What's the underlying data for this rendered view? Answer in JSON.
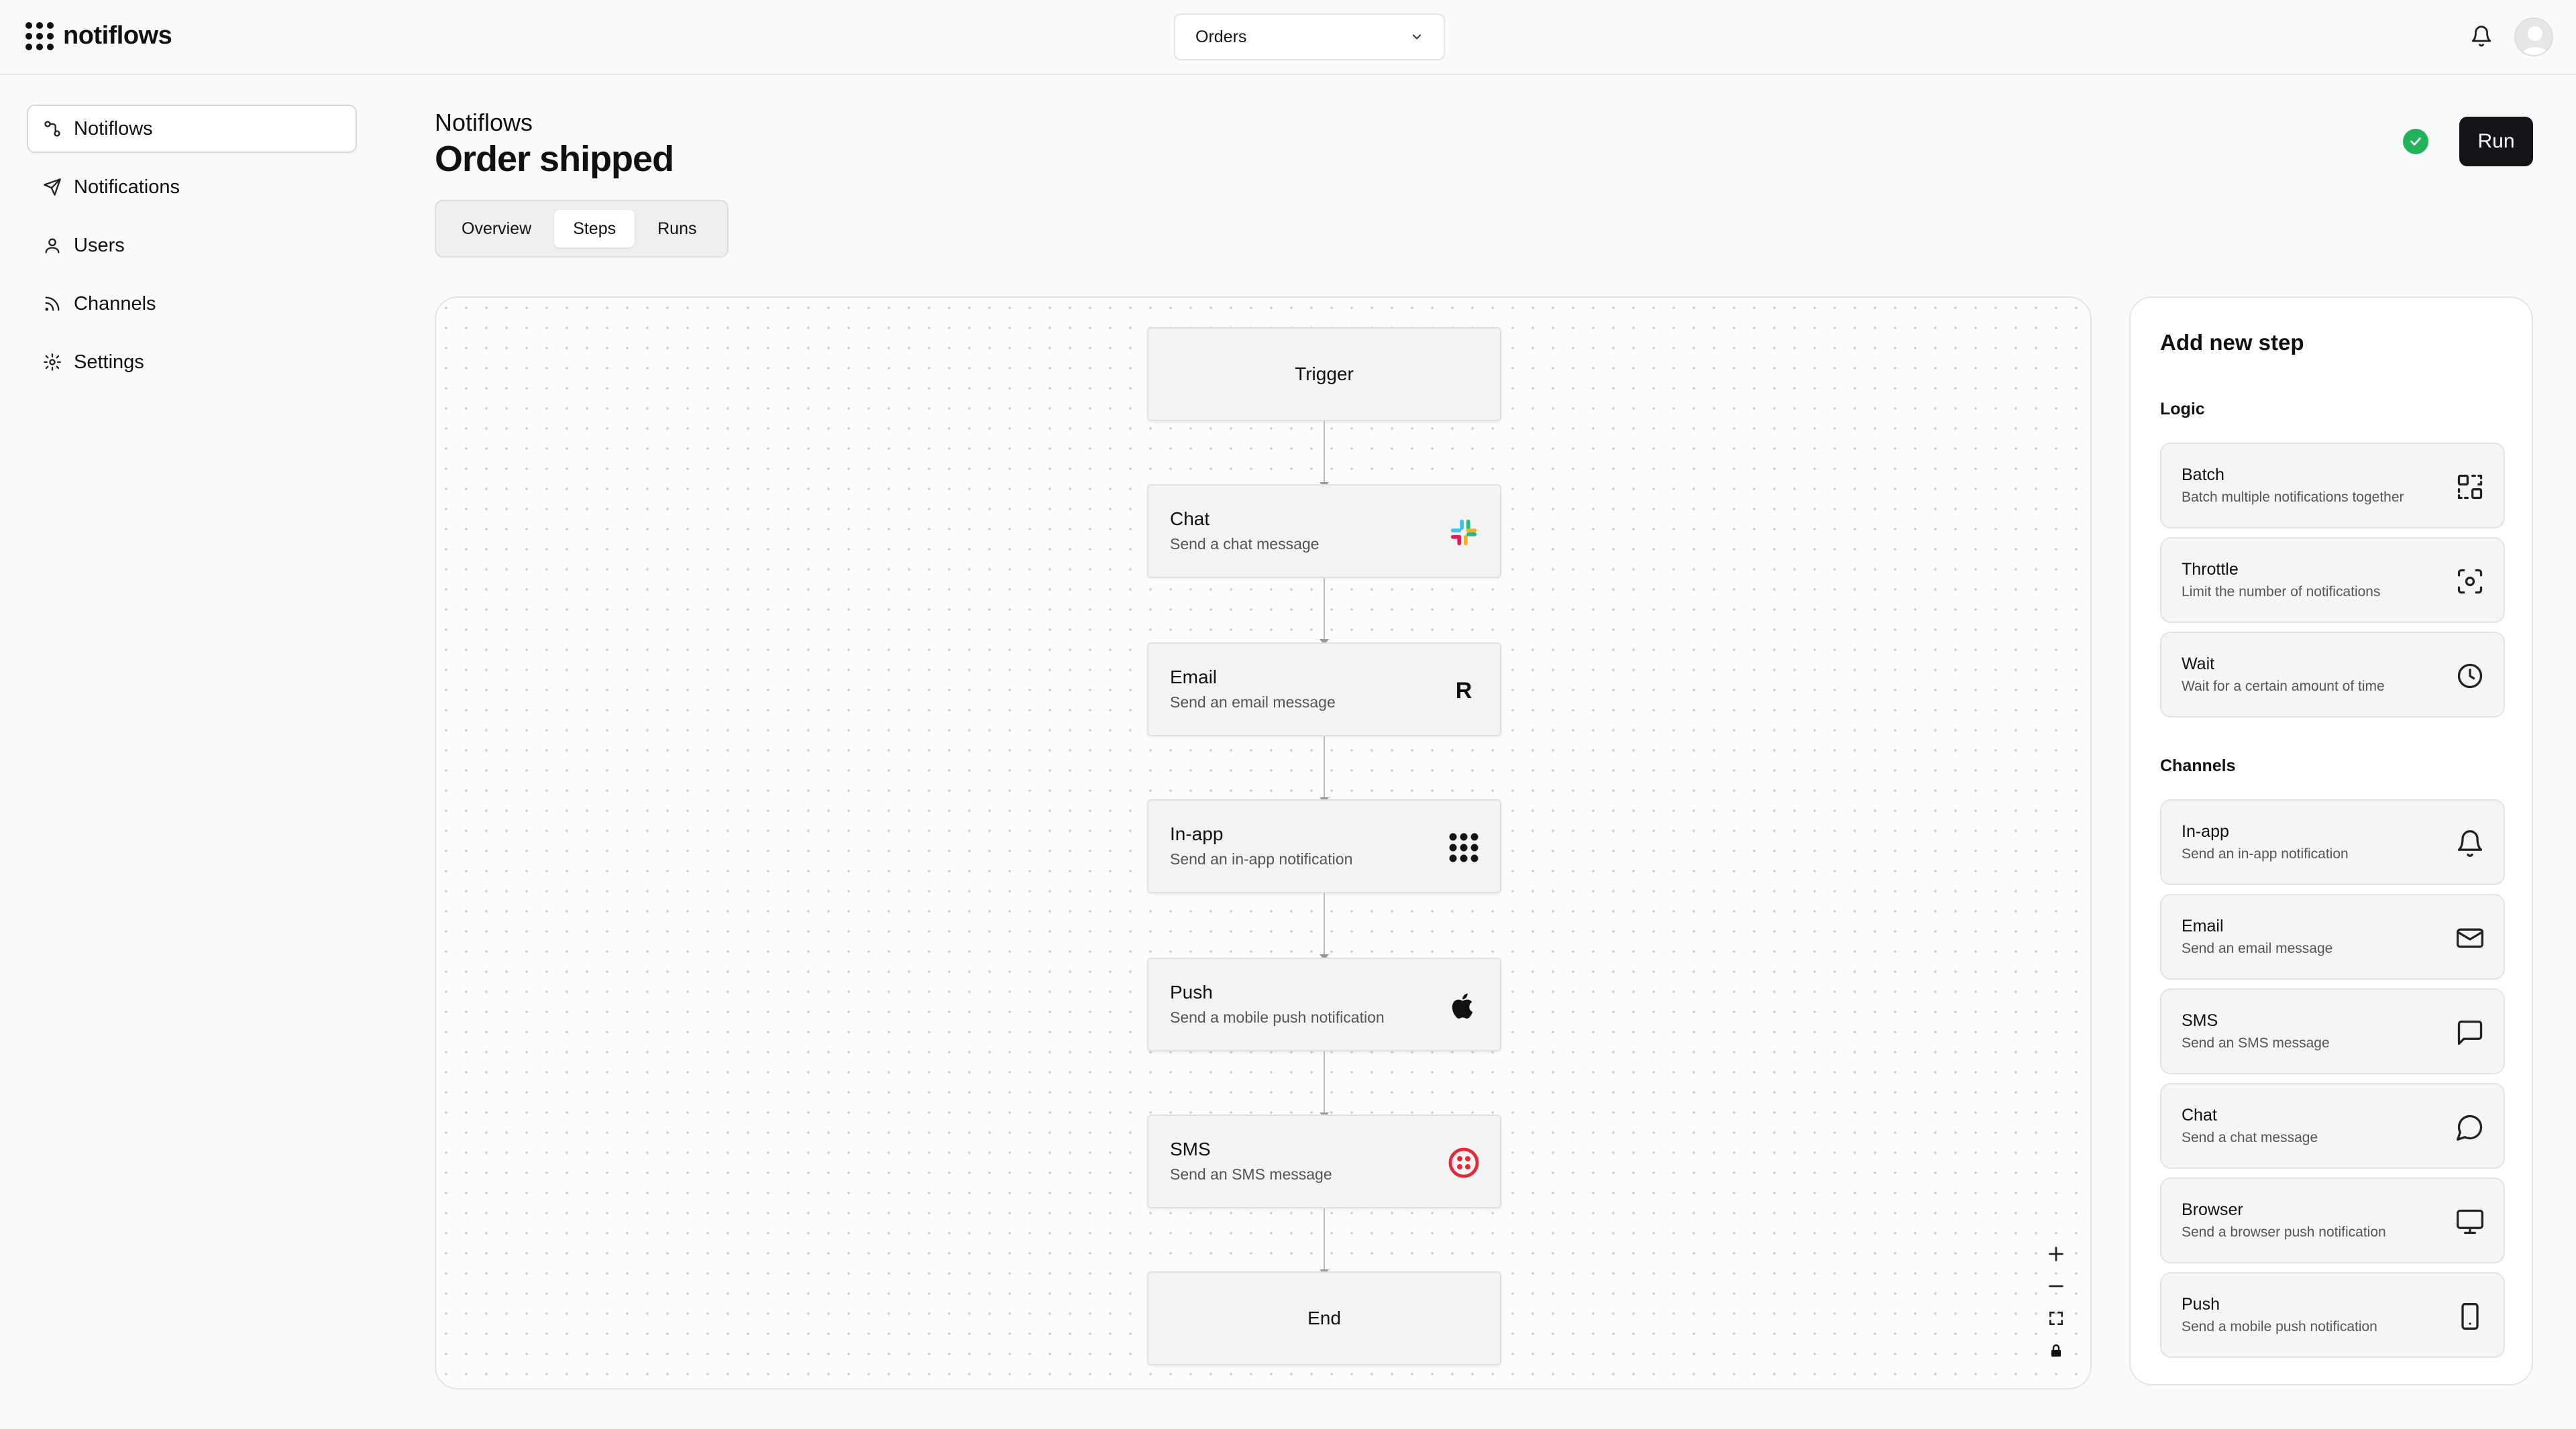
{
  "app": {
    "name": "notiflows"
  },
  "header": {
    "workflow_select": "Orders",
    "icons": [
      "grid-logo-icon",
      "chevron-down-icon",
      "bell-icon",
      "avatar"
    ]
  },
  "sidebar": {
    "items": [
      {
        "label": "Notiflows",
        "icon": "workflow-icon",
        "active": true
      },
      {
        "label": "Notifications",
        "icon": "send-icon"
      },
      {
        "label": "Users",
        "icon": "user-icon"
      },
      {
        "label": "Channels",
        "icon": "rss-icon"
      },
      {
        "label": "Settings",
        "icon": "gear-icon"
      }
    ]
  },
  "page": {
    "breadcrumb": "Notiflows",
    "title": "Order shipped",
    "run_label": "Run",
    "status_color": "#21b35a",
    "tabs": [
      {
        "label": "Overview"
      },
      {
        "label": "Steps",
        "active": true
      },
      {
        "label": "Runs"
      }
    ]
  },
  "flow": {
    "trigger": "Trigger",
    "end": "End",
    "steps": [
      {
        "title": "Chat",
        "subtitle": "Send a chat message",
        "icon": "slack-icon"
      },
      {
        "title": "Email",
        "subtitle": "Send an email message",
        "icon": "resend-icon",
        "icon_text": "R"
      },
      {
        "title": "In-app",
        "subtitle": "Send an in-app notification",
        "icon": "notiflows-dots-icon"
      },
      {
        "title": "Push",
        "subtitle": "Send a mobile push notification",
        "icon": "apple-icon"
      },
      {
        "title": "SMS",
        "subtitle": "Send an SMS message",
        "icon": "twilio-icon"
      }
    ],
    "controls": [
      "zoom-in-icon",
      "zoom-out-icon",
      "fit-view-icon",
      "lock-icon"
    ]
  },
  "panel": {
    "title": "Add new step",
    "logic_label": "Logic",
    "logic": [
      {
        "title": "Batch",
        "subtitle": "Batch multiple notifications together",
        "icon": "batch-icon"
      },
      {
        "title": "Throttle",
        "subtitle": "Limit the number of notifications",
        "icon": "throttle-icon"
      },
      {
        "title": "Wait",
        "subtitle": "Wait for a certain amount of time",
        "icon": "clock-icon"
      }
    ],
    "channels_label": "Channels",
    "channels": [
      {
        "title": "In-app",
        "subtitle": "Send an in-app notification",
        "icon": "bell-icon"
      },
      {
        "title": "Email",
        "subtitle": "Send an email message",
        "icon": "mail-icon"
      },
      {
        "title": "SMS",
        "subtitle": "Send an SMS message",
        "icon": "message-square-icon"
      },
      {
        "title": "Chat",
        "subtitle": "Send a chat message",
        "icon": "message-circle-icon"
      },
      {
        "title": "Browser",
        "subtitle": "Send a browser push notification",
        "icon": "monitor-icon"
      },
      {
        "title": "Push",
        "subtitle": "Send a mobile push notification",
        "icon": "smartphone-icon"
      }
    ]
  }
}
